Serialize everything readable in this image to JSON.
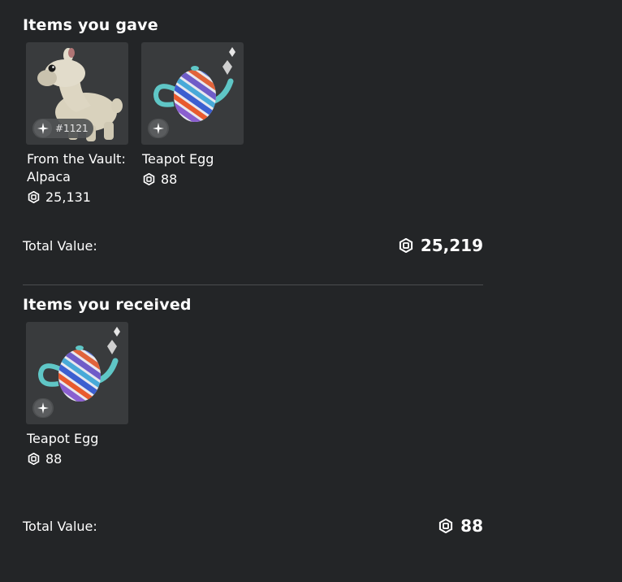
{
  "gave": {
    "title": "Items you gave",
    "items": [
      {
        "name": "From the Vault: Alpaca",
        "price": "25,131",
        "serial": "#1121",
        "icon": "limited-icon"
      },
      {
        "name": "Teapot Egg",
        "price": "88",
        "icon": "limited-icon"
      }
    ],
    "total_label": "Total Value:",
    "total_value": "25,219"
  },
  "received": {
    "title": "Items you received",
    "items": [
      {
        "name": "Teapot Egg",
        "price": "88",
        "icon": "limited-icon"
      }
    ],
    "total_label": "Total Value:",
    "total_value": "88"
  },
  "colors": {
    "background": "#232527",
    "card": "#393b3d",
    "divider": "#4a4c4e",
    "text": "#ffffff"
  }
}
